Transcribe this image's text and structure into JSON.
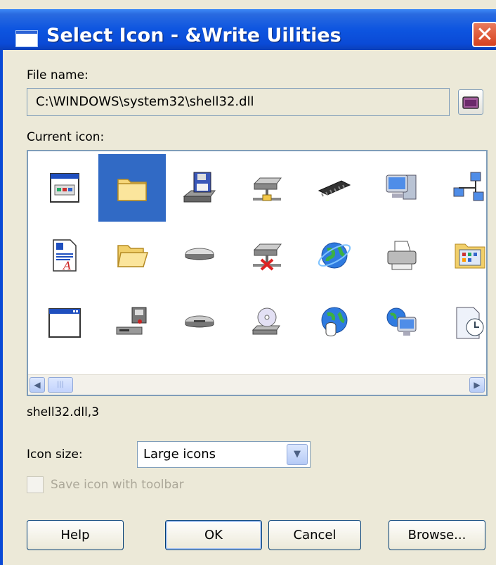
{
  "dialog": {
    "title": "Select Icon - &Write Uilities",
    "close_glyph": "✕"
  },
  "file_name": {
    "label": "File name:",
    "value": "C:\\WINDOWS\\system32\\shell32.dll"
  },
  "current_icon": {
    "label": "Current icon:",
    "selected_index": 3,
    "icons": [
      [
        "window-icon",
        "folder-icon",
        "floppy-drive-icon",
        "network-drive-icon",
        "memory-chip-icon",
        "computer-icon",
        "network-icon"
      ],
      [
        "document-icon",
        "open-folder-icon",
        "hard-drive-icon",
        "disconnected-drive-icon",
        "globe-icon",
        "printer-icon",
        "control-panel-folder-icon"
      ],
      [
        "blank-window-icon",
        "run-icon",
        "removable-drive-icon",
        "cd-drive-icon",
        "globe-mouse-icon",
        "network-globe-icon",
        "clock-document-icon"
      ]
    ]
  },
  "status": "shell32.dll,3",
  "icon_size": {
    "label": "Icon size:",
    "selected": "Large icons"
  },
  "save_with_toolbar": {
    "label": "Save icon with toolbar",
    "checked": false
  },
  "buttons": {
    "help": "Help",
    "ok": "OK",
    "cancel": "Cancel",
    "browse": "Browse..."
  },
  "colors": {
    "title_bar": "#0a4ad6",
    "selection": "#316ac5",
    "dialog_bg": "#ece9d8",
    "close_button": "#d7411e"
  }
}
